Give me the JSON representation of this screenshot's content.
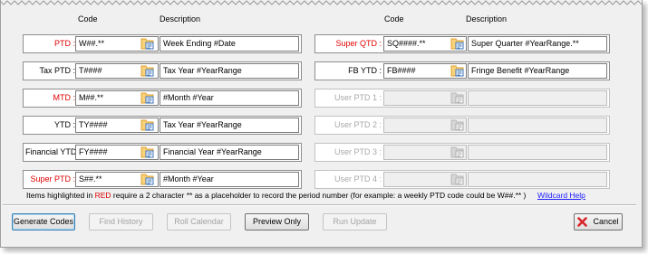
{
  "headers": {
    "left_code": "Code",
    "left_description": "Description",
    "right_code": "Code",
    "right_description": "Description"
  },
  "left_rows": [
    {
      "label": "PTD :",
      "code": "W##.**",
      "description": "Week Ending #Date",
      "label_color": "red",
      "enabled": true
    },
    {
      "label": "Tax PTD :",
      "code": "T####",
      "description": "Tax Year #YearRange",
      "label_color": "black",
      "enabled": true
    },
    {
      "label": "MTD :",
      "code": "M##.**",
      "description": "#Month #Year",
      "label_color": "red",
      "enabled": true
    },
    {
      "label": "YTD :",
      "code": "TY####",
      "description": "Tax Year #YearRange",
      "label_color": "black",
      "enabled": true
    },
    {
      "label": "Financial YTD :",
      "code": "FY####",
      "description": "Financial Year #YearRange",
      "label_color": "black",
      "enabled": true
    },
    {
      "label": "Super PTD :",
      "code": "S##.**",
      "description": "#Month #Year",
      "label_color": "red",
      "enabled": true
    }
  ],
  "right_rows": [
    {
      "label": "Super QTD :",
      "code": "SQ####.**",
      "description": "Super Quarter #YearRange.**",
      "label_color": "red",
      "enabled": true
    },
    {
      "label": "FB YTD :",
      "code": "FB####",
      "description": "Fringe Benefit #YearRange",
      "label_color": "black",
      "enabled": true
    },
    {
      "label": "User PTD 1 :",
      "code": "",
      "description": "",
      "label_color": "grey",
      "enabled": false
    },
    {
      "label": "User PTD 2 :",
      "code": "",
      "description": "",
      "label_color": "grey",
      "enabled": false
    },
    {
      "label": "User PTD 3 :",
      "code": "",
      "description": "",
      "label_color": "grey",
      "enabled": false
    },
    {
      "label": "User PTD 4 :",
      "code": "",
      "description": "",
      "label_color": "grey",
      "enabled": false
    }
  ],
  "note": {
    "before": "Items highlighted in ",
    "highlight": "RED",
    "after": " require a 2 character ** as a placeholder to record the period number (for example: a weekly PTD code could be W##.** )"
  },
  "wildcard_help": "Wildcard Help",
  "buttons": {
    "generate_codes": "Generate Codes",
    "find_history": "Find History",
    "roll_calendar": "Roll Calendar",
    "preview_only": "Preview Only",
    "run_update": "Run Update",
    "cancel": "Cancel"
  },
  "icons": {
    "row_picker": "folder-list-icon",
    "cancel": "red-x-icon"
  },
  "colors": {
    "required_label": "#e00000",
    "disabled_label": "#a8a8a8",
    "link": "#1a1aff",
    "panel_background": "#f0f0f0"
  }
}
